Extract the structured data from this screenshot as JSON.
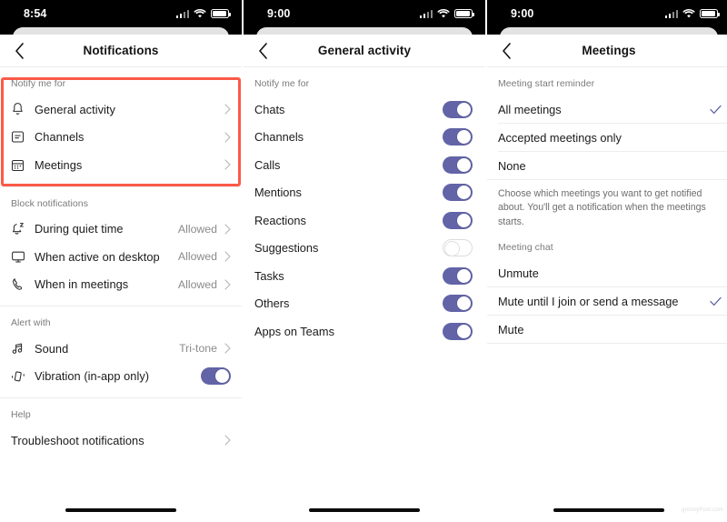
{
  "brand": {
    "accent": "#6264a7",
    "highlight": "#fa5a48"
  },
  "watermark": "groovyPost.com",
  "panels": [
    {
      "status": {
        "time": "8:54"
      },
      "nav": {
        "title": "Notifications",
        "back": "back-chevron"
      },
      "sections": [
        {
          "label": "Notify me for",
          "rows": [
            {
              "icon": "bell-icon",
              "label": "General activity",
              "value": "",
              "accessory": "chevron"
            },
            {
              "icon": "channels-icon",
              "label": "Channels",
              "value": "",
              "accessory": "chevron"
            },
            {
              "icon": "calendar-icon",
              "label": "Meetings",
              "value": "",
              "accessory": "chevron"
            }
          ]
        },
        {
          "label": "Block notifications",
          "rows": [
            {
              "icon": "bell-sleep-icon",
              "label": "During quiet time",
              "value": "Allowed",
              "accessory": "chevron"
            },
            {
              "icon": "desktop-icon",
              "label": "When active on desktop",
              "value": "Allowed",
              "accessory": "chevron"
            },
            {
              "icon": "phone-icon",
              "label": "When in meetings",
              "value": "Allowed",
              "accessory": "chevron"
            }
          ]
        },
        {
          "label": "Alert with",
          "rows": [
            {
              "icon": "music-note-icon",
              "label": "Sound",
              "value": "Tri-tone",
              "accessory": "chevron"
            },
            {
              "icon": "vibration-icon",
              "label": "Vibration (in-app only)",
              "value": "",
              "accessory": "toggle-on"
            }
          ]
        },
        {
          "label": "Help",
          "rows": [
            {
              "icon": "",
              "label": "Troubleshoot notifications",
              "value": "",
              "accessory": "chevron"
            }
          ]
        }
      ]
    },
    {
      "status": {
        "time": "9:00"
      },
      "nav": {
        "title": "General activity",
        "back": "back-chevron"
      },
      "sections": [
        {
          "label": "Notify me for",
          "rows": [
            {
              "label": "Chats",
              "toggle": "on"
            },
            {
              "label": "Channels",
              "toggle": "on"
            },
            {
              "label": "Calls",
              "toggle": "on"
            },
            {
              "label": "Mentions",
              "toggle": "on"
            },
            {
              "label": "Reactions",
              "toggle": "on"
            },
            {
              "label": "Suggestions",
              "toggle": "off"
            },
            {
              "label": "Tasks",
              "toggle": "on"
            },
            {
              "label": "Others",
              "toggle": "on"
            },
            {
              "label": "Apps on Teams",
              "toggle": "on"
            }
          ]
        }
      ]
    },
    {
      "status": {
        "time": "9:00"
      },
      "nav": {
        "title": "Meetings",
        "back": "back-chevron"
      },
      "sections": [
        {
          "label": "Meeting start reminder",
          "rows": [
            {
              "label": "All meetings",
              "selected": true
            },
            {
              "label": "Accepted meetings only",
              "selected": false
            },
            {
              "label": "None",
              "selected": false
            }
          ],
          "footnote": "Choose which meetings you want to get notified about. You'll get a notification when the meetings starts."
        },
        {
          "label": "Meeting chat",
          "rows": [
            {
              "label": "Unmute",
              "selected": false
            },
            {
              "label": "Mute until I join or send a message",
              "selected": true
            },
            {
              "label": "Mute",
              "selected": false
            }
          ]
        }
      ]
    }
  ]
}
